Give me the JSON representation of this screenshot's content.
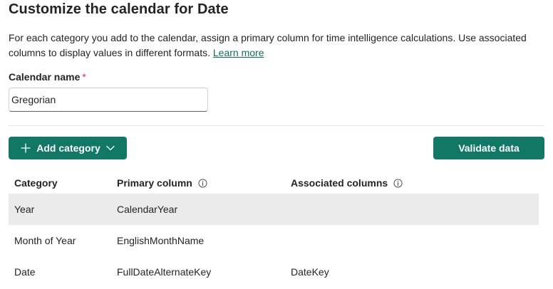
{
  "page": {
    "title": "Customize the calendar for Date",
    "description": "For each category you add to the calendar, assign a primary column for time intelligence calculations. Use associated columns to display values in different formats.",
    "learn_more": "Learn more"
  },
  "calendar_name": {
    "label": "Calendar name",
    "required_mark": "*",
    "value": "Gregorian"
  },
  "toolbar": {
    "add_category_label": "Add category",
    "validate_label": "Validate data"
  },
  "table": {
    "headers": [
      "Category",
      "Primary column",
      "Associated columns"
    ],
    "rows": [
      {
        "category": "Year",
        "primary": "CalendarYear",
        "associated": ""
      },
      {
        "category": "Month of Year",
        "primary": "EnglishMonthName",
        "associated": ""
      },
      {
        "category": "Date",
        "primary": "FullDateAlternateKey",
        "associated": "DateKey"
      }
    ]
  },
  "colors": {
    "accent": "#117865",
    "link": "#0f6f5c",
    "required": "#c4314b",
    "selected_row": "#ebebeb"
  },
  "icons": {
    "add": "plus-icon",
    "dropdown": "chevron-down-icon",
    "info": "info-icon"
  }
}
